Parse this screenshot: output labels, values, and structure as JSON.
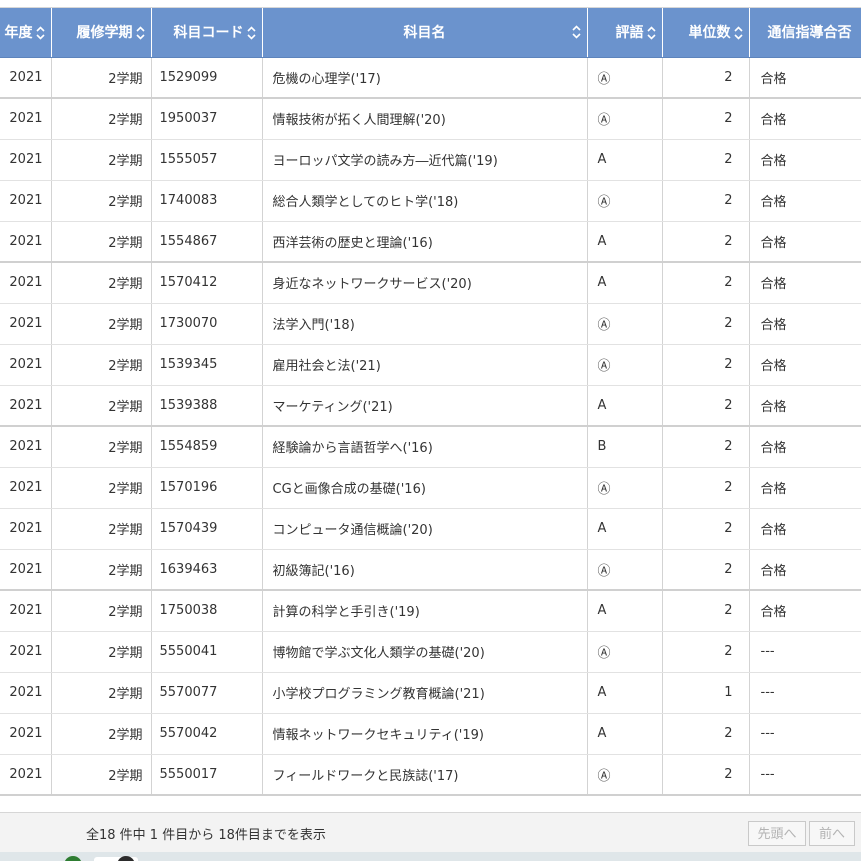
{
  "table": {
    "headers": {
      "year": "年度",
      "term": "履修学期",
      "code": "科目コード",
      "name": "科目名",
      "grade": "評語",
      "credits": "単位数",
      "pass": "通信指導合否"
    },
    "rows": [
      {
        "year": "2021",
        "term": "2学期",
        "code": "1529099",
        "name": "危機の心理学('17)",
        "grade": "Ⓐ",
        "credits": "2",
        "pass": "合格"
      },
      {
        "year": "2021",
        "term": "2学期",
        "code": "1950037",
        "name": "情報技術が拓く人間理解('20)",
        "grade": "Ⓐ",
        "credits": "2",
        "pass": "合格"
      },
      {
        "year": "2021",
        "term": "2学期",
        "code": "1555057",
        "name": "ヨーロッパ文学の読み方―近代篇('19)",
        "grade": "A",
        "credits": "2",
        "pass": "合格"
      },
      {
        "year": "2021",
        "term": "2学期",
        "code": "1740083",
        "name": "総合人類学としてのヒト学('18)",
        "grade": "Ⓐ",
        "credits": "2",
        "pass": "合格"
      },
      {
        "year": "2021",
        "term": "2学期",
        "code": "1554867",
        "name": "西洋芸術の歴史と理論('16)",
        "grade": "A",
        "credits": "2",
        "pass": "合格"
      },
      {
        "year": "2021",
        "term": "2学期",
        "code": "1570412",
        "name": "身近なネットワークサービス('20)",
        "grade": "A",
        "credits": "2",
        "pass": "合格"
      },
      {
        "year": "2021",
        "term": "2学期",
        "code": "1730070",
        "name": "法学入門('18)",
        "grade": "Ⓐ",
        "credits": "2",
        "pass": "合格"
      },
      {
        "year": "2021",
        "term": "2学期",
        "code": "1539345",
        "name": "雇用社会と法('21)",
        "grade": "Ⓐ",
        "credits": "2",
        "pass": "合格"
      },
      {
        "year": "2021",
        "term": "2学期",
        "code": "1539388",
        "name": "マーケティング('21)",
        "grade": "A",
        "credits": "2",
        "pass": "合格"
      },
      {
        "year": "2021",
        "term": "2学期",
        "code": "1554859",
        "name": "経験論から言語哲学へ('16)",
        "grade": "B",
        "credits": "2",
        "pass": "合格"
      },
      {
        "year": "2021",
        "term": "2学期",
        "code": "1570196",
        "name": "CGと画像合成の基礎('16)",
        "grade": "Ⓐ",
        "credits": "2",
        "pass": "合格"
      },
      {
        "year": "2021",
        "term": "2学期",
        "code": "1570439",
        "name": "コンピュータ通信概論('20)",
        "grade": "A",
        "credits": "2",
        "pass": "合格"
      },
      {
        "year": "2021",
        "term": "2学期",
        "code": "1639463",
        "name": "初級簿記('16)",
        "grade": "Ⓐ",
        "credits": "2",
        "pass": "合格"
      },
      {
        "year": "2021",
        "term": "2学期",
        "code": "1750038",
        "name": "計算の科学と手引き('19)",
        "grade": "A",
        "credits": "2",
        "pass": "合格"
      },
      {
        "year": "2021",
        "term": "2学期",
        "code": "5550041",
        "name": "博物館で学ぶ文化人類学の基礎('20)",
        "grade": "Ⓐ",
        "credits": "2",
        "pass": "---"
      },
      {
        "year": "2021",
        "term": "2学期",
        "code": "5570077",
        "name": "小学校プログラミング教育概論('21)",
        "grade": "A",
        "credits": "1",
        "pass": "---"
      },
      {
        "year": "2021",
        "term": "2学期",
        "code": "5570042",
        "name": "情報ネットワークセキュリティ('19)",
        "grade": "A",
        "credits": "2",
        "pass": "---"
      },
      {
        "year": "2021",
        "term": "2学期",
        "code": "5550017",
        "name": "フィールドワークと民族誌('17)",
        "grade": "Ⓐ",
        "credits": "2",
        "pass": "---"
      }
    ]
  },
  "footer": {
    "summary": "全18 件中 1 件目から 18件目までを表示",
    "first_label": "先頭へ",
    "prev_label": "前へ"
  },
  "icons": {
    "sort": "sort-updown-icon"
  },
  "colors": {
    "header_bg": "#6b93cd",
    "header_text": "#ffffff",
    "footer_bg": "#f3f3f3"
  }
}
